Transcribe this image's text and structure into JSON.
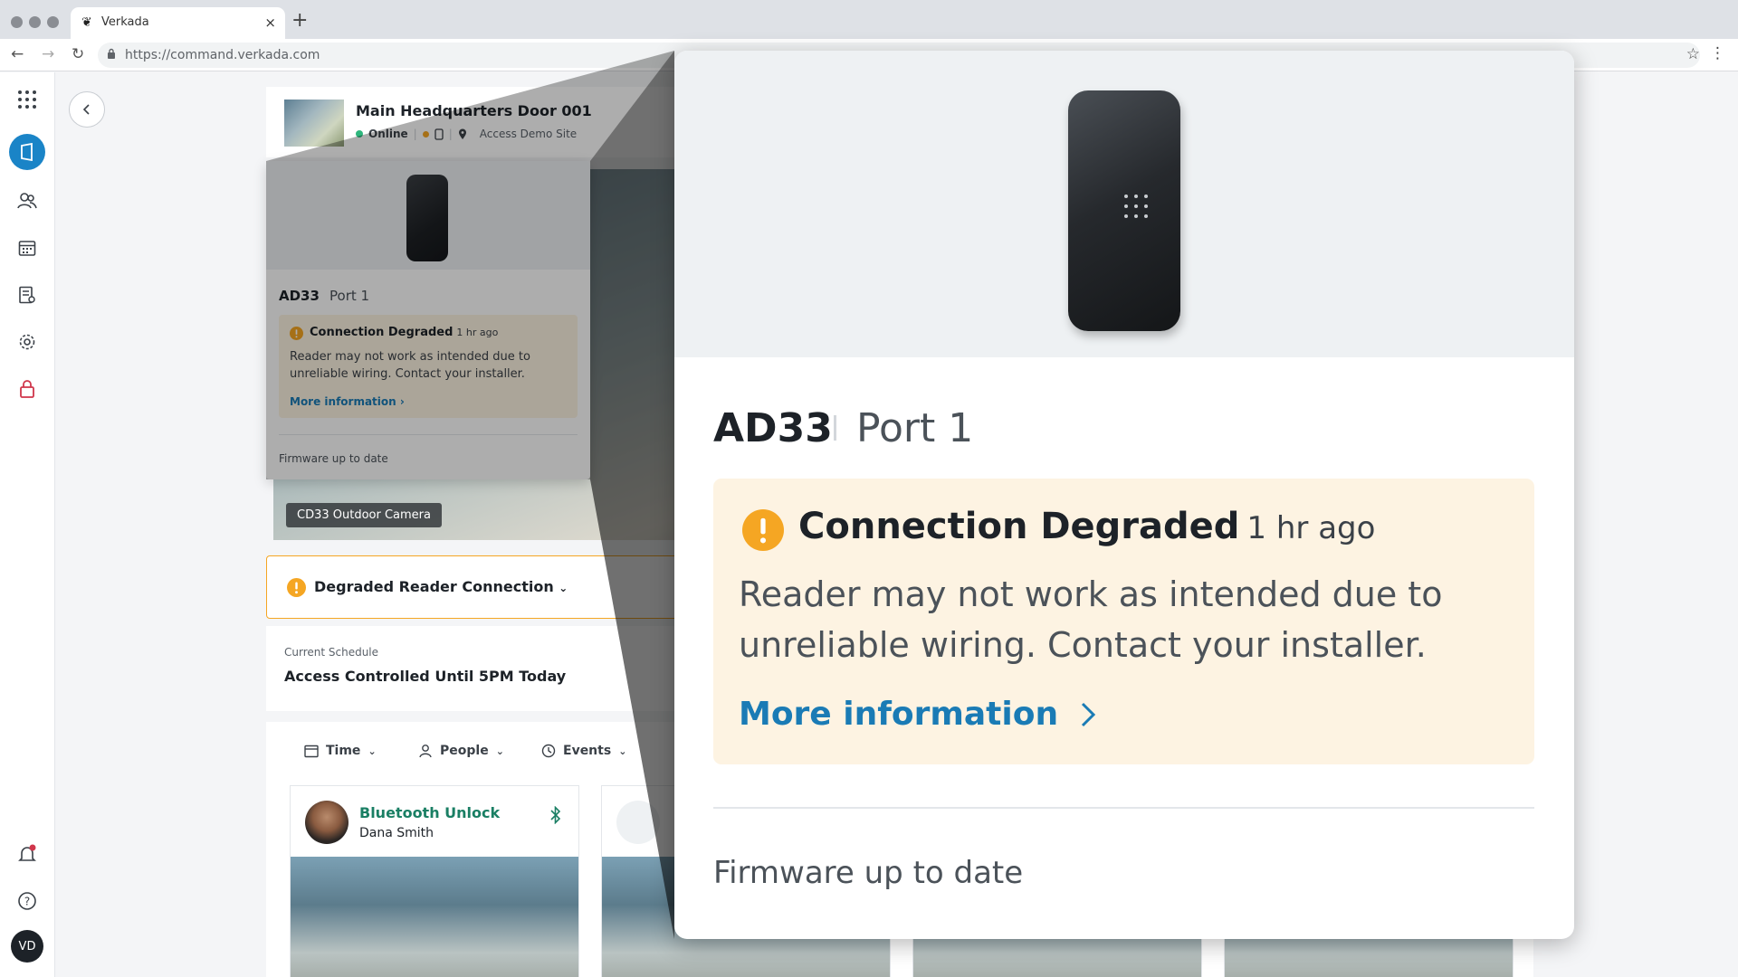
{
  "browser": {
    "tab_title": "Verkada",
    "tab_close": "×",
    "new_tab": "+",
    "url": "https://command.verkada.com"
  },
  "door": {
    "title": "Main Headquarters Door 001",
    "status": "Online",
    "site": "Access Demo Site"
  },
  "camera": {
    "label": "CD33 Outdoor Camera"
  },
  "alert_bar": {
    "text": "Degraded Reader Connection"
  },
  "schedule": {
    "caption": "Current Schedule",
    "value": "Access Controlled Until 5PM Today"
  },
  "filters": {
    "time": "Time",
    "people": "People",
    "events": "Events"
  },
  "events": [
    {
      "title": "Bluetooth Unlock",
      "person": "Dana Smith"
    }
  ],
  "reader": {
    "model": "AD33",
    "port": "Port 1",
    "alert_title": "Connection Degraded",
    "alert_time": "1 hr ago",
    "alert_body": "Reader may not work as intended due to unreliable wiring. Contact your installer.",
    "more_info": "More information",
    "firmware": "Firmware up to date"
  },
  "user": {
    "initials": "VD"
  },
  "colors": {
    "accent": "#1a84c7",
    "link": "#1a7bb5",
    "warning": "#f5a623",
    "warning_bg": "#fdf3e2",
    "online": "#2eb67d",
    "event_title": "#1a7f64"
  },
  "icons": {
    "rail": [
      "apps-grid-icon",
      "access-door-icon",
      "people-icon",
      "calendar-icon",
      "reports-icon",
      "settings-icon",
      "lock-icon",
      "bell-icon",
      "help-icon"
    ],
    "reader_warning": "warning-icon"
  }
}
